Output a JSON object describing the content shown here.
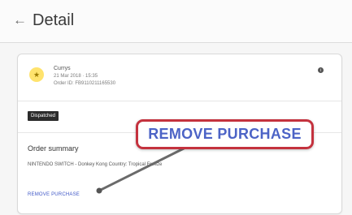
{
  "header": {
    "back_glyph": "←",
    "title": "Detail"
  },
  "order": {
    "store_icon": "★",
    "store_name": "Currys",
    "date": "21 Mar 2018 · 15:35",
    "order_id": "Order ID: FB9110211165530",
    "info_glyph": "i",
    "status": "Dispatched"
  },
  "summary": {
    "heading": "Order summary",
    "item": "NINTENDO SWITCH - Donkey Kong Country: Tropical Freeze",
    "remove_label": "REMOVE PURCHASE"
  },
  "annotation": {
    "callout_label": "REMOVE PURCHASE",
    "color": "#c4323e"
  }
}
